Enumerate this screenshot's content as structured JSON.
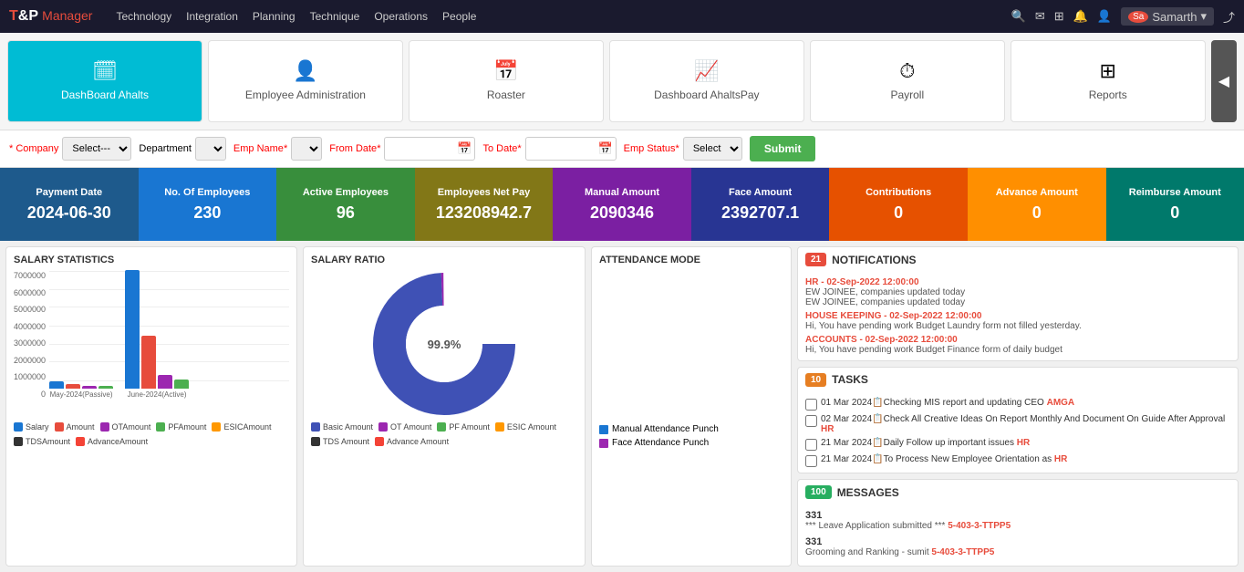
{
  "brand": {
    "name": "T&P",
    "highlight": "T",
    "sub": "Manager"
  },
  "nav": {
    "links": [
      "Technology",
      "Integration",
      "Planning",
      "Technique",
      "Operations",
      "People"
    ],
    "user": "Samarth"
  },
  "cards": [
    {
      "id": "dashboard-ahalts",
      "icon": "🗓",
      "label": "DashBoard Ahalts",
      "active": true
    },
    {
      "id": "employee-admin",
      "icon": "👤",
      "label": "Employee Administration",
      "active": false
    },
    {
      "id": "roaster",
      "icon": "📅",
      "label": "Roaster",
      "active": false
    },
    {
      "id": "dashboard-ahalts-pay",
      "icon": "📈",
      "label": "Dashboard AhaltsPay",
      "active": false
    },
    {
      "id": "payroll",
      "icon": "⏱",
      "label": "Payroll",
      "active": false
    },
    {
      "id": "reports",
      "icon": "⊞",
      "label": "Reports",
      "active": false
    }
  ],
  "filters": {
    "company_label": "Company",
    "company_placeholder": "Select---",
    "department_label": "Department",
    "emp_name_label": "Emp Name",
    "from_date_label": "From Date",
    "to_date_label": "To Date",
    "emp_status_label": "Emp Status",
    "emp_status_placeholder": "Select",
    "submit_label": "Submit"
  },
  "stats": [
    {
      "label": "Payment Date",
      "value": "2024-06-30",
      "color": "blue-dark"
    },
    {
      "label": "No. Of Employees",
      "value": "230",
      "color": "blue-mid"
    },
    {
      "label": "Active Employees",
      "value": "96",
      "color": "green"
    },
    {
      "label": "Employees Net Pay",
      "value": "123208942.7",
      "color": "olive"
    },
    {
      "label": "Manual Amount",
      "value": "2090346",
      "color": "purple"
    },
    {
      "label": "Face Amount",
      "value": "2392707.1",
      "color": "indigo"
    },
    {
      "label": "Contributions",
      "value": "0",
      "color": "orange"
    },
    {
      "label": "Advance Amount",
      "value": "0",
      "color": "amber"
    },
    {
      "label": "Reimburse Amount",
      "value": "0",
      "color": "teal"
    }
  ],
  "salary_stats": {
    "title": "SALARY STATISTICS",
    "y_labels": [
      "7000000",
      "6000000",
      "5000000",
      "4000000",
      "3000000",
      "2000000",
      "1000000",
      "0"
    ],
    "groups": [
      {
        "label": "May-2024(Passive)",
        "bars": [
          {
            "color": "#1976d2",
            "height": 10,
            "name": "Salary"
          },
          {
            "color": "#e74c3c",
            "height": 8,
            "name": "Amount"
          },
          {
            "color": "#9c27b0",
            "height": 6,
            "name": "OTAmount"
          },
          {
            "color": "#4caf50",
            "height": 5,
            "name": "PFAmount"
          }
        ]
      },
      {
        "label": "June-2024(Active)",
        "bars": [
          {
            "color": "#1976d2",
            "height": 130,
            "name": "Salary"
          },
          {
            "color": "#e74c3c",
            "height": 60,
            "name": "Amount"
          },
          {
            "color": "#9c27b0",
            "height": 15,
            "name": "OTAmount"
          },
          {
            "color": "#4caf50",
            "height": 10,
            "name": "PFAmount"
          }
        ]
      }
    ],
    "legend": [
      {
        "color": "#1976d2",
        "label": "Salary"
      },
      {
        "color": "#e74c3c",
        "label": "Amount"
      },
      {
        "color": "#9c27b0",
        "label": "OTAmount"
      },
      {
        "color": "#4caf50",
        "label": "PFAmount"
      },
      {
        "color": "#ff9800",
        "label": "ESICAmount"
      },
      {
        "color": "#333",
        "label": "TDSAmount"
      },
      {
        "color": "#f44336",
        "label": "AdvanceAmount"
      }
    ]
  },
  "salary_ratio": {
    "title": "SALARY RATIO",
    "donut_value": "99.9%",
    "legend": [
      {
        "color": "#3f51b5",
        "label": "Basic Amount"
      },
      {
        "color": "#9c27b0",
        "label": "OT Amount"
      },
      {
        "color": "#4caf50",
        "label": "PF Amount"
      },
      {
        "color": "#ff9800",
        "label": "ESIC Amount"
      },
      {
        "color": "#333",
        "label": "TDS Amount"
      },
      {
        "color": "#f44336",
        "label": "Advance Amount"
      }
    ],
    "segments": [
      {
        "color": "#3f51b5",
        "percent": 99.9
      },
      {
        "color": "#9c27b0",
        "percent": 0.1
      }
    ]
  },
  "attendance_mode": {
    "title": "ATTENDANCE MODE",
    "legend": [
      {
        "color": "#1976d2",
        "label": "Manual Attendance Punch"
      },
      {
        "color": "#9c27b0",
        "label": "Face Attendance Punch"
      }
    ]
  },
  "notifications": {
    "badge": "21",
    "title": "NOTIFICATIONS",
    "items": [
      {
        "link": "HR - 02-Sep-2022 12:00:00",
        "texts": [
          "EW JOINEE, companies updated today",
          "EW JOINEE, companies updated today"
        ]
      },
      {
        "link": "HOUSE KEEPING - 02-Sep-2022 12:00:00",
        "texts": [
          "Hi, You have pending work Budget Laundry form not filled yesterday."
        ]
      },
      {
        "link": "ACCOUNTS - 02-Sep-2022 12:00:00",
        "texts": [
          "Hi, You have pending work Budget Finance form of daily budget"
        ]
      }
    ]
  },
  "tasks": {
    "badge": "10",
    "title": "TASKS",
    "items": [
      {
        "text": "01 Mar 2024 📋 Checking MIS report and updating CEO",
        "link": "AMGA"
      },
      {
        "text": "02 Mar 2024 📋 Check All Creative Ideas On Report Monthly And Document On Guide After Approval",
        "link": "HR"
      },
      {
        "text": "21 Mar 2024 📋 Daily Follow up important issues",
        "link": "HR"
      },
      {
        "text": "21 Mar 2024 📋 To Process New Employee Orientation as",
        "link": "HR"
      }
    ]
  },
  "messages": {
    "badge": "100",
    "title": "MESSAGES",
    "items": [
      {
        "num": "331",
        "text": "*** Leave Application submitted ***",
        "link": "5-403-3-TTPP5"
      },
      {
        "num": "331",
        "text": "Grooming and Ranking - sumit",
        "link": "5-403-3-TTPP5"
      }
    ]
  }
}
